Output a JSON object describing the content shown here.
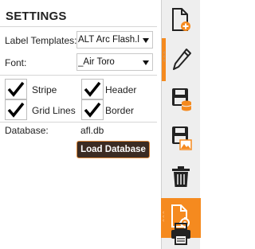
{
  "settings": {
    "title": "SETTINGS",
    "label_templates": {
      "label": "Label Templates:",
      "value": "ALT Arc Flash.lfaf"
    },
    "font": {
      "label": "Font:",
      "value": "_Air Toro"
    },
    "checkboxes": [
      {
        "label": "Stripe",
        "checked": true
      },
      {
        "label": "Header",
        "checked": true
      },
      {
        "label": "Grid Lines",
        "checked": true
      },
      {
        "label": "Border",
        "checked": true
      }
    ],
    "database": {
      "label": "Database:",
      "value": "afl.db",
      "load_button": "Load Database"
    }
  },
  "toolbar": {
    "items": [
      {
        "name": "new-document",
        "icon": "document-plus-icon",
        "active": false
      },
      {
        "name": "edit",
        "icon": "pencil-icon",
        "active": false
      },
      {
        "name": "save-to-database",
        "icon": "save-database-icon",
        "active": false
      },
      {
        "name": "save-image",
        "icon": "save-image-icon",
        "active": false
      },
      {
        "name": "delete",
        "icon": "trash-icon",
        "active": false
      },
      {
        "name": "document-settings",
        "icon": "document-gear-icon",
        "active": true
      },
      {
        "name": "print",
        "icon": "printer-icon",
        "active": false
      }
    ]
  },
  "colors": {
    "accent": "#f58a1f",
    "button_bg": "#3b2b22",
    "toolbar_bg": "#eeeeee"
  }
}
